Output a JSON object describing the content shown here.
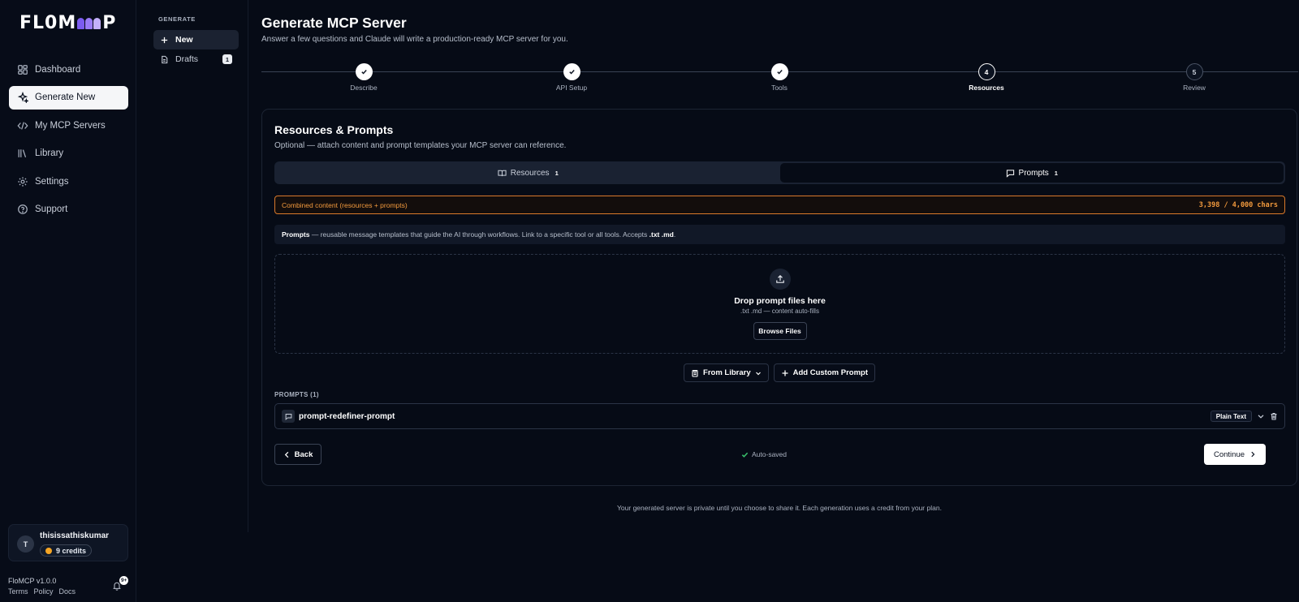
{
  "app": {
    "logo_text_left": "FL0M",
    "logo_text_right": "P",
    "version": "FloMCP v1.0.0",
    "footer_links": [
      "Terms",
      "Policy",
      "Docs"
    ],
    "notification_badge": "9+"
  },
  "sidebar": {
    "items": [
      {
        "label": "Dashboard",
        "icon": "dashboard-icon",
        "active": false
      },
      {
        "label": "Generate New",
        "icon": "sparkles-icon",
        "active": true
      },
      {
        "label": "My MCP Servers",
        "icon": "code-icon",
        "active": false
      },
      {
        "label": "Library",
        "icon": "library-icon",
        "active": false
      },
      {
        "label": "Settings",
        "icon": "gear-icon",
        "active": false
      },
      {
        "label": "Support",
        "icon": "help-icon",
        "active": false
      }
    ]
  },
  "user": {
    "initial": "T",
    "name": "thisissathiskumar",
    "credits": "9 credits"
  },
  "subnav": {
    "section": "GENERATE",
    "items": [
      {
        "label": "New",
        "icon": "plus-icon",
        "active": true,
        "count": ""
      },
      {
        "label": "Drafts",
        "icon": "document-icon",
        "active": false,
        "count": "1"
      }
    ]
  },
  "header": {
    "title": "Generate MCP Server",
    "subtitle": "Answer a few questions and Claude will write a production-ready MCP server for you."
  },
  "stepper": {
    "steps": [
      {
        "label": "Describe",
        "state": "done",
        "number": "1"
      },
      {
        "label": "API Setup",
        "state": "done",
        "number": "2"
      },
      {
        "label": "Tools",
        "state": "done",
        "number": "3"
      },
      {
        "label": "Resources",
        "state": "current",
        "number": "4"
      },
      {
        "label": "Review",
        "state": "todo",
        "number": "5"
      }
    ]
  },
  "card": {
    "title": "Resources & Prompts",
    "subtitle": "Optional — attach content and prompt templates your MCP server can reference.",
    "tabs": [
      {
        "label": "Resources",
        "count": "1",
        "icon": "book-icon",
        "active": false
      },
      {
        "label": "Prompts",
        "count": "1",
        "icon": "message-icon",
        "active": true
      }
    ],
    "warning": {
      "label": "Combined content (resources + prompts)",
      "value": "3,398 / 4,000 chars",
      "color": "#f39a3d"
    },
    "info": {
      "bold": "Prompts",
      "text": " — reusable message templates that guide the AI through workflows. Link to a specific tool or all tools. Accepts ",
      "formats": ".txt .md",
      "end": "."
    },
    "dropzone": {
      "title": "Drop prompt files here",
      "subtitle": ".txt .md — content auto-fills",
      "browse_label": "Browse Files"
    },
    "actions": {
      "from_library": "From Library",
      "add_custom": "Add Custom Prompt"
    },
    "list": {
      "title": "PROMPTS (1)",
      "items": [
        {
          "name": "prompt-redefiner-prompt",
          "format": "Plain Text"
        }
      ]
    },
    "footer": {
      "back": "Back",
      "saved": "Auto-saved",
      "continue": "Continue"
    }
  },
  "disclaimer": "Your generated server is private until you choose to share it. Each generation uses a credit from your plan.",
  "colors": {
    "background": "#060b16",
    "accent_warning": "#d9792b",
    "success": "#39c16c",
    "logo_purple": "#7c5cf0"
  }
}
